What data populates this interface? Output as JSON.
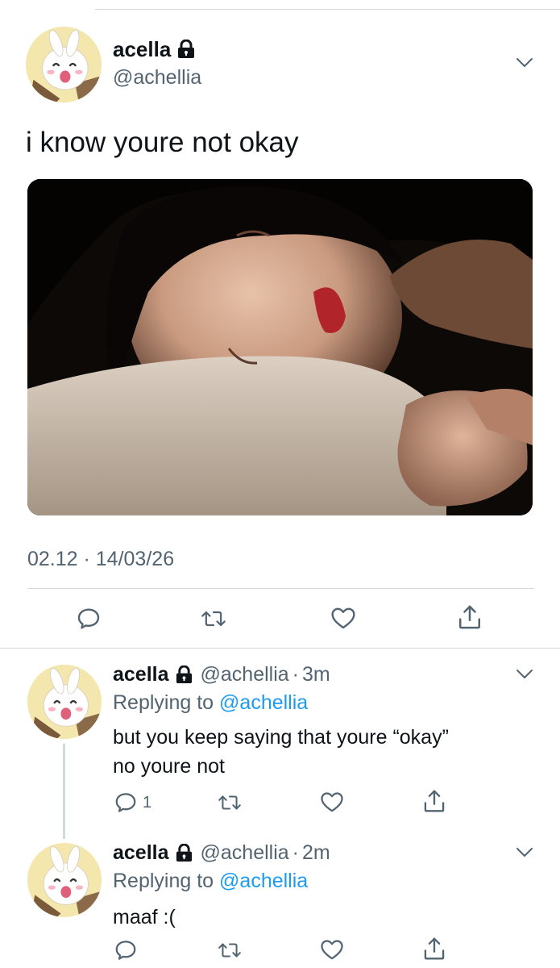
{
  "tweet": {
    "author_name": "acella",
    "author_handle": "@achellia",
    "text": "i know youre not okay",
    "timestamp": "02.12 · 14/03/26",
    "icons": {
      "lock": "lock-icon",
      "menu": "chevron-down-icon",
      "reply": "reply-icon",
      "retweet": "retweet-icon",
      "like": "heart-icon",
      "share": "share-icon"
    }
  },
  "replies": [
    {
      "author_name": "acella",
      "author_handle": "@achellia",
      "separator": "·",
      "time": "3m",
      "replying_label": "Replying to",
      "replying_to": "@achellia",
      "text_lines": [
        "but you keep saying that youre “okay”",
        "no youre not"
      ],
      "reply_count": "1"
    },
    {
      "author_name": "acella",
      "author_handle": "@achellia",
      "separator": "·",
      "time": "2m",
      "replying_label": "Replying to",
      "replying_to": "@achellia",
      "text_lines": [
        "maaf :("
      ],
      "reply_count": ""
    }
  ],
  "colors": {
    "text": "#0f1419",
    "secondary": "#536471",
    "link": "#1d9bf0",
    "divider": "#cfd9de"
  }
}
